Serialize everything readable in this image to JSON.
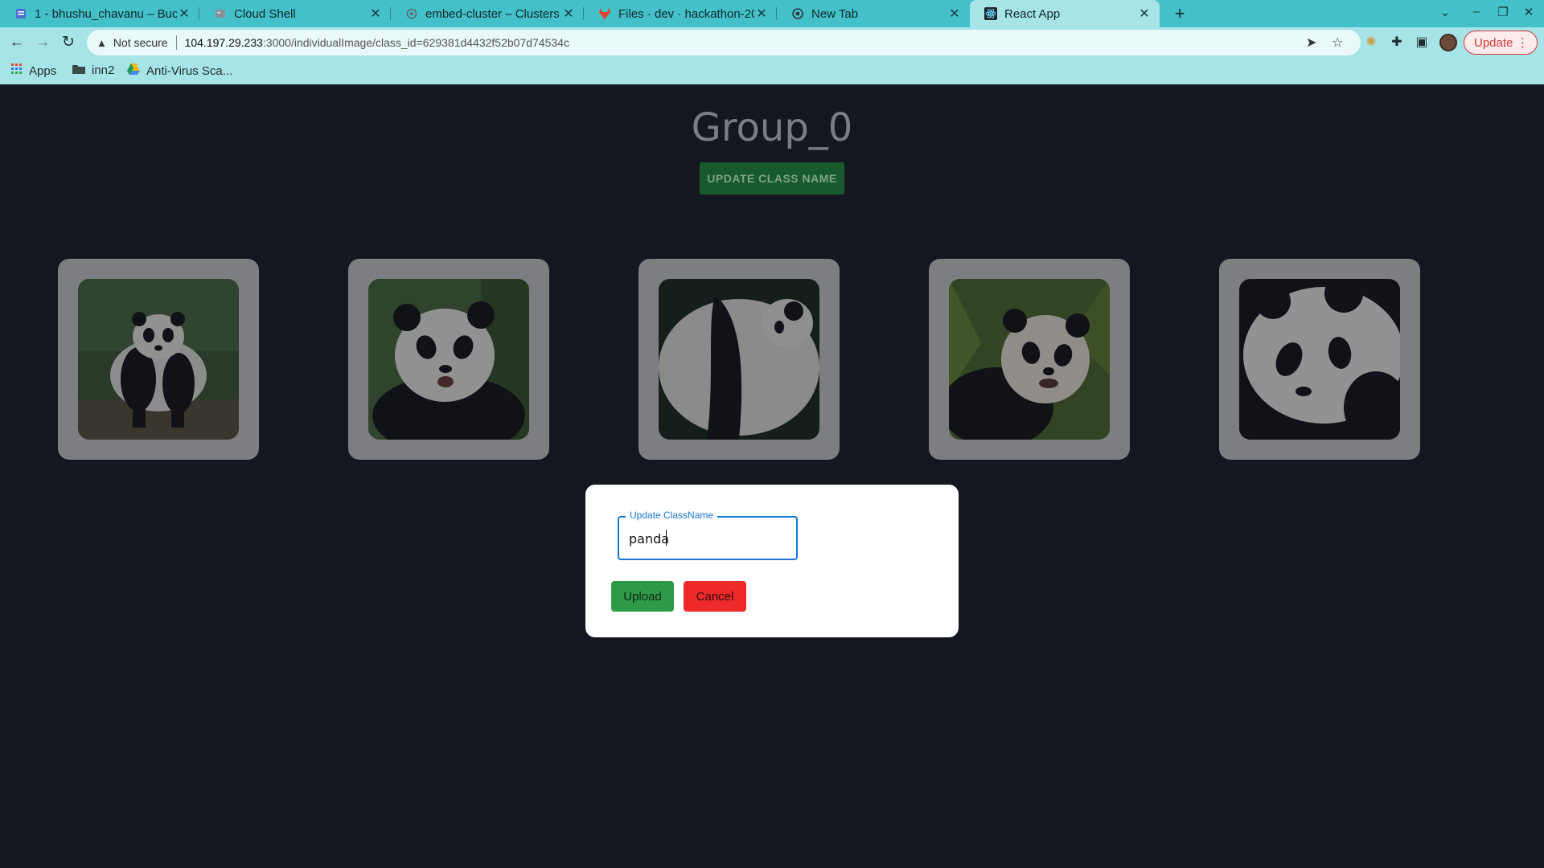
{
  "browser": {
    "tabs": [
      {
        "title": "1 - bhushu_chavanu – Buc",
        "icon": "doc-icon",
        "active": false
      },
      {
        "title": "Cloud Shell",
        "icon": "cloud-shell-icon",
        "active": false
      },
      {
        "title": "embed-cluster – Clusters",
        "icon": "cluster-icon",
        "active": false
      },
      {
        "title": "Files · dev · hackathon-202",
        "icon": "gitlab-icon",
        "active": false
      },
      {
        "title": "New Tab",
        "icon": "chrome-icon",
        "active": false
      },
      {
        "title": "React App",
        "icon": "react-icon",
        "active": true
      }
    ],
    "new_tab_label": "+",
    "security_label": "Not secure",
    "url_host": "104.197.29.233",
    "url_path": ":3000/individualImage/class_id=629381d4432f52b07d74534c",
    "update_label": "Update",
    "bookmarks": [
      {
        "label": "Apps",
        "icon": "apps-grid-icon"
      },
      {
        "label": "inn2",
        "icon": "folder-icon"
      },
      {
        "label": "Anti-Virus Sca...",
        "icon": "drive-icon"
      }
    ]
  },
  "page": {
    "group_title": "Group_0",
    "update_class_button": "UPDATE CLASS NAME",
    "images": [
      {
        "subject": "panda standing"
      },
      {
        "subject": "panda sitting"
      },
      {
        "subject": "panda lying"
      },
      {
        "subject": "panda in bamboo"
      },
      {
        "subject": "panda face"
      }
    ]
  },
  "modal": {
    "field_label": "Update ClassName",
    "field_value": "panda",
    "upload_button": "Upload",
    "cancel_button": "Cancel"
  },
  "colors": {
    "chrome": "#43c0c8",
    "toolbar": "#a7e4e8",
    "page_bg": "#14171f",
    "accent_green": "#2e9a48",
    "danger_red": "#ef2a2a",
    "focus_blue": "#1976d2"
  }
}
